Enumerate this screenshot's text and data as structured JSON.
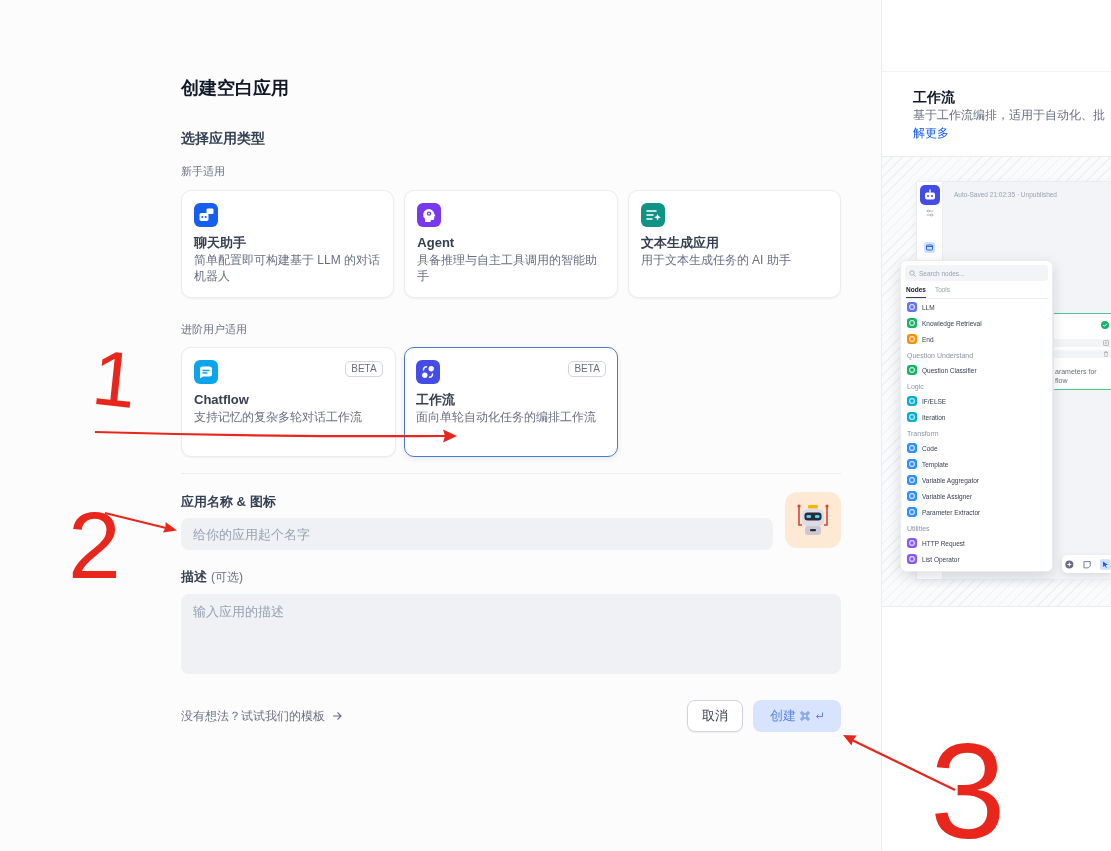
{
  "title": "创建空白应用",
  "app_types": {
    "title": "选择应用类型",
    "groups": [
      {
        "label": "新手适用",
        "cards": [
          {
            "kind": "chat",
            "title": "聊天助手",
            "description": "简单配置即可构建基于 LLM 的对话机器人",
            "selected": false
          },
          {
            "kind": "agent",
            "title": "Agent",
            "description": "具备推理与自主工具调用的智能助手",
            "selected": false
          },
          {
            "kind": "completion",
            "title": "文本生成应用",
            "description": "用于文本生成任务的 AI 助手",
            "selected": false
          }
        ]
      },
      {
        "label": "进阶用户适用",
        "cards": [
          {
            "kind": "chatflow",
            "title": "Chatflow",
            "description": "支持记忆的复杂多轮对话工作流",
            "badge": "BETA",
            "selected": false
          },
          {
            "kind": "workflow",
            "title": "工作流",
            "description": "面向单轮自动化任务的编排工作流",
            "badge": "BETA",
            "selected": true
          }
        ]
      }
    ]
  },
  "name_field": {
    "label": "应用名称 & 图标",
    "placeholder": "给你的应用起个名字"
  },
  "description_field": {
    "label": "描述",
    "hint": "(可选)",
    "placeholder": "输入应用的描述"
  },
  "template_link": "没有想法？试试我们的模板",
  "buttons": {
    "cancel": "取消",
    "create": {
      "label": "创建",
      "disabled": true
    }
  },
  "preview": {
    "title": "工作流",
    "description": "基于工作流编排，适用于自动化、批",
    "link": "解更多",
    "status": "Auto-Saved 21:02:35 · Unpublished",
    "search_placeholder": "Search nodes...",
    "tabs": [
      {
        "label": "Nodes",
        "selected": true
      },
      {
        "label": "Tools",
        "selected": false
      }
    ],
    "node_groups": [
      {
        "items": [
          {
            "label": "LLM",
            "color": "#6172f3"
          },
          {
            "label": "Knowledge Retrieval",
            "color": "#16b364"
          },
          {
            "label": "End",
            "color": "#f79009"
          }
        ]
      },
      {
        "title": "Question Understand",
        "items": [
          {
            "label": "Question Classifier",
            "color": "#16b364"
          }
        ]
      },
      {
        "title": "Logic",
        "items": [
          {
            "label": "IF/ELSE",
            "color": "#06aed4"
          },
          {
            "label": "Iteration",
            "color": "#06aed4"
          }
        ]
      },
      {
        "title": "Transform",
        "items": [
          {
            "label": "Code",
            "color": "#2e90fa"
          },
          {
            "label": "Template",
            "color": "#2e90fa"
          },
          {
            "label": "Variable Aggregator",
            "color": "#2e90fa"
          },
          {
            "label": "Variable Assigner",
            "color": "#2e90fa"
          },
          {
            "label": "Parameter Extractor",
            "color": "#2e90fa"
          }
        ]
      },
      {
        "title": "Utilities",
        "items": [
          {
            "label": "HTTP Request",
            "color": "#875bf7"
          },
          {
            "label": "List Operator",
            "color": "#875bf7"
          }
        ]
      }
    ],
    "node_card_text": [
      "arameters for",
      "flow"
    ]
  },
  "annotations": [
    {
      "label": "1"
    },
    {
      "label": "2"
    },
    {
      "label": "3"
    }
  ]
}
